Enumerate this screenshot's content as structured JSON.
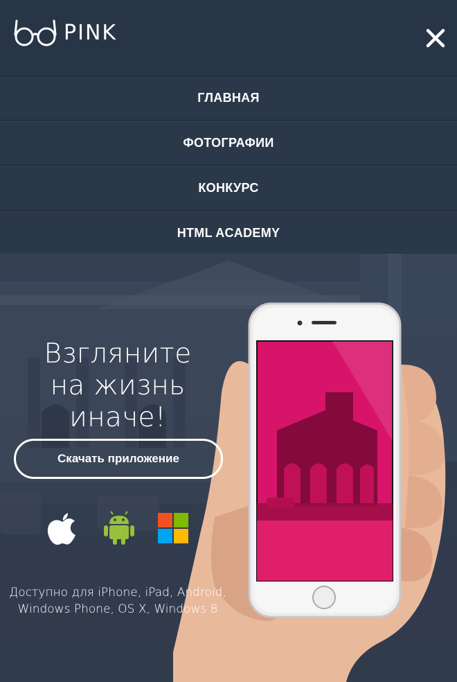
{
  "header": {
    "logo_text": "PINK",
    "close_label": "✕"
  },
  "nav": {
    "items": [
      {
        "label": "ГЛАВНАЯ"
      },
      {
        "label": "ФОТОГРАФИИ"
      },
      {
        "label": "КОНКУРС"
      },
      {
        "label": "HTML ACADEMY"
      }
    ]
  },
  "hero": {
    "title_lines": [
      "Взгляните",
      "на жизнь",
      "иначе!"
    ],
    "download_label": "Скачать приложение",
    "platforms": [
      {
        "icon": "apple-icon"
      },
      {
        "icon": "android-icon"
      },
      {
        "icon": "windows-icon"
      }
    ],
    "availability_lines": [
      "Доступно для iPhone, iPad, Android,",
      "Windows Phone, OS X, Windows 8"
    ]
  },
  "colors": {
    "background": "#283547",
    "accent_pink": "#e0206a",
    "android_green": "#97c03c"
  }
}
